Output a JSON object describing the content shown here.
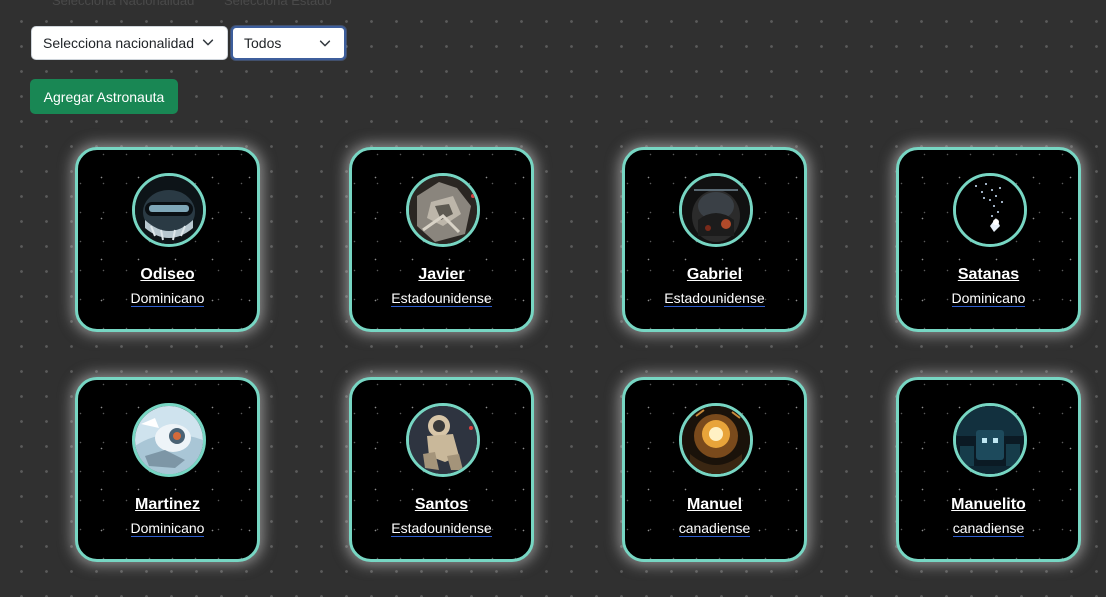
{
  "filters": {
    "label_nacionalidad": "Selecciona Nacionalidad",
    "label_estado": "Selecciona Estado",
    "nacionalidad_value": "Selecciona nacionalidad",
    "estado_value": "Todos"
  },
  "actions": {
    "add_label": "Agregar Astronauta"
  },
  "colors": {
    "card_border": "#77d6c3",
    "add_button": "#198754",
    "nat_underline": "#2f5fd0"
  },
  "astronauts": [
    {
      "name": "Odiseo",
      "nationality": "Dominicano"
    },
    {
      "name": "Javier",
      "nationality": "Estadounidense"
    },
    {
      "name": "Gabriel",
      "nationality": "Estadounidense"
    },
    {
      "name": "Satanas",
      "nationality": "Dominicano"
    },
    {
      "name": "Martinez",
      "nationality": "Dominicano"
    },
    {
      "name": "Santos",
      "nationality": "Estadounidense"
    },
    {
      "name": "Manuel",
      "nationality": "canadiense"
    },
    {
      "name": "Manuelito",
      "nationality": "canadiense"
    }
  ]
}
